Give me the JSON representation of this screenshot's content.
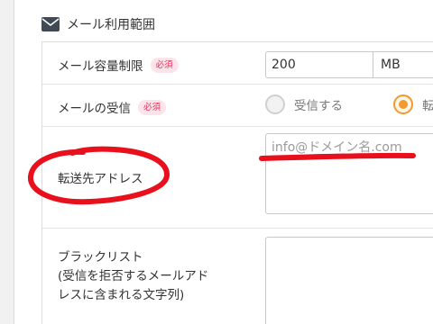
{
  "section": {
    "title": "メール利用範囲",
    "icon": "envelope-icon"
  },
  "rows": {
    "capacity": {
      "label": "メール容量制限",
      "badge": "必須",
      "value": "200",
      "unit": "MB"
    },
    "receive": {
      "label": "メールの受信",
      "badge": "必須",
      "option_receive": "受信する",
      "option_forward": "転",
      "selected": "forward"
    },
    "forward": {
      "label": "転送先アドレス",
      "placeholder": "info@ドメイン名.com"
    },
    "blacklist": {
      "label_line1": "ブラックリスト",
      "label_line2": "(受信を拒否するメールアド",
      "label_line3": "レスに含まれる文字列)",
      "value": ""
    }
  },
  "colors": {
    "accent": "#f39a2b",
    "badge_text": "#e2315a",
    "badge_bg": "#fde3ea",
    "annotation": "#e8101c"
  }
}
